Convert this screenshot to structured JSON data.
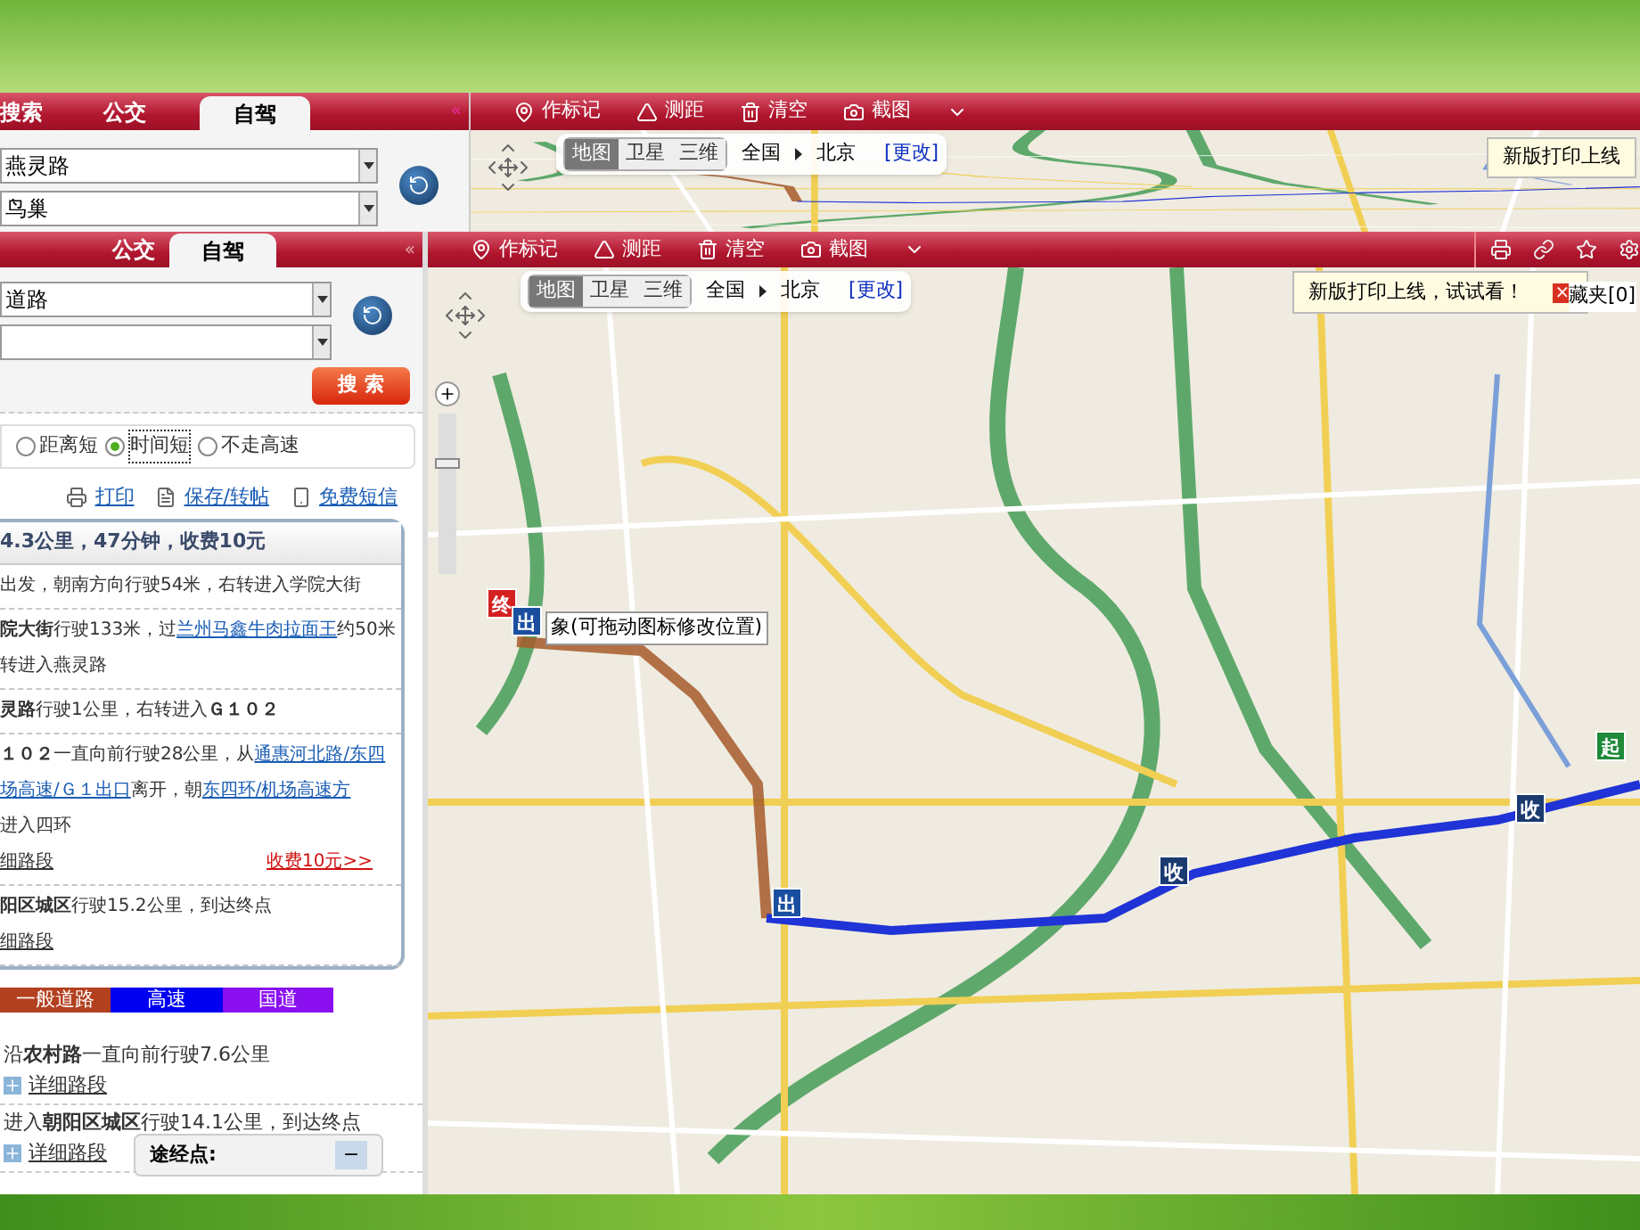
{
  "back_window": {
    "tabs": [
      {
        "label": "搜索",
        "selected": false
      },
      {
        "label": "公交",
        "selected": false
      },
      {
        "label": "自驾",
        "selected": true
      }
    ],
    "collapse": "«",
    "start_field": {
      "value": "燕灵路"
    },
    "end_field": {
      "value": "鸟巢"
    },
    "toolbar": [
      {
        "kind": "pin",
        "label": "作标记"
      },
      {
        "kind": "ruler",
        "label": "测距"
      },
      {
        "kind": "trash",
        "label": "清空"
      },
      {
        "kind": "camera",
        "label": "截图"
      },
      {
        "kind": "more"
      }
    ],
    "map_types": [
      {
        "label": "地图",
        "selected": true
      },
      {
        "label": "卫星",
        "selected": false
      },
      {
        "label": "三维",
        "selected": false
      }
    ],
    "region": "全国",
    "city": "北京",
    "change_link": "[更改]",
    "tooltip": "新版打印上线"
  },
  "front_window": {
    "tabs": [
      {
        "label": "公交",
        "selected": false
      },
      {
        "label": "自驾",
        "selected": true
      }
    ],
    "collapse": "«",
    "start_field": {
      "value": "道路"
    },
    "search_button": "搜 索",
    "route_options": [
      {
        "label": "距离短",
        "selected": false
      },
      {
        "label": "时间短",
        "selected": true
      },
      {
        "label": "不走高速",
        "selected": false
      }
    ],
    "actions": [
      {
        "kind": "print",
        "label": "打印"
      },
      {
        "kind": "save",
        "label": "保存/转帖"
      },
      {
        "kind": "phone",
        "label": "免费短信"
      }
    ],
    "summary": "4.3公里，47分钟，收费10元",
    "steps": [
      {
        "lines": [
          [
            {
              "kind": "text",
              "text": "出发，朝南方向行驶54米，右转进入学院大街"
            }
          ]
        ]
      },
      {
        "lines": [
          [
            {
              "kind": "text",
              "text": "**院大街**行驶133米，过"
            },
            {
              "kind": "link",
              "text": "兰州马鑫牛肉拉面王"
            },
            {
              "kind": "text",
              "text": "约50米"
            }
          ],
          [
            {
              "kind": "text",
              "text": "转进入燕灵路"
            }
          ]
        ]
      },
      {
        "lines": [
          [
            {
              "kind": "text",
              "text": "**灵路**行驶1公里，右转进入**Ｇ１０２**"
            }
          ]
        ]
      },
      {
        "lines": [
          [
            {
              "kind": "text",
              "text": "**１０２**一直向前行驶28公里，从"
            },
            {
              "kind": "link",
              "text": "通惠河北路/东四"
            }
          ],
          [
            {
              "kind": "link",
              "text": "场高速/Ｇ１出口"
            },
            {
              "kind": "text",
              "text": "离开，朝"
            },
            {
              "kind": "link",
              "text": "东四环/机场高速方"
            }
          ],
          [
            {
              "kind": "text",
              "text": "进入四环"
            }
          ],
          [
            {
              "kind": "detail",
              "text": "细路段"
            },
            {
              "kind": "toll",
              "text": "收费10元>>"
            }
          ]
        ]
      },
      {
        "lines": [
          [
            {
              "kind": "text",
              "text": "**阳区城区**行驶15.2公里，到达终点"
            }
          ],
          [
            {
              "kind": "detail",
              "text": "细路段"
            }
          ]
        ]
      }
    ],
    "legend": [
      {
        "label": "一般道路",
        "color": "#b3401f"
      },
      {
        "label": "高速",
        "color": "#0000f0"
      },
      {
        "label": "国道",
        "color": "#8a10f0"
      }
    ],
    "more_steps": [
      {
        "text": "沿**农村路**一直向前行驶7.6公里",
        "detail": "详细路段"
      },
      {
        "text": "进入**朝阳区城区**行驶14.1公里，到达终点",
        "detail": "详细路段"
      }
    ],
    "waypoint_panel": {
      "label": "途经点:",
      "button": "−"
    },
    "toolbar": [
      {
        "kind": "pin",
        "label": "作标记"
      },
      {
        "kind": "ruler",
        "label": "测距"
      },
      {
        "kind": "trash",
        "label": "清空"
      },
      {
        "kind": "camera",
        "label": "截图"
      },
      {
        "kind": "more"
      }
    ],
    "map_types": [
      {
        "label": "地图",
        "selected": true
      },
      {
        "label": "卫星",
        "selected": false
      },
      {
        "label": "三维",
        "selected": false
      }
    ],
    "region": "全国",
    "city": "北京",
    "change_link": "[更改]",
    "zoom": {
      "level": 0.7
    },
    "tooltip": {
      "text": "新版打印上线，试试看！",
      "close": "×"
    },
    "favorites": "藏夹[0]",
    "map_hint": "象(可拖动图标修改位置)",
    "markers": [
      {
        "label": "终",
        "color": "#d42020"
      },
      {
        "label": "出",
        "color": "#1a4fa0"
      },
      {
        "label": "出",
        "color": "#1a4fa0"
      },
      {
        "label": "收",
        "color": "#1a3a70"
      },
      {
        "label": "收",
        "color": "#1a3a70"
      },
      {
        "label": "起",
        "color": "#1f8a3a"
      }
    ]
  }
}
